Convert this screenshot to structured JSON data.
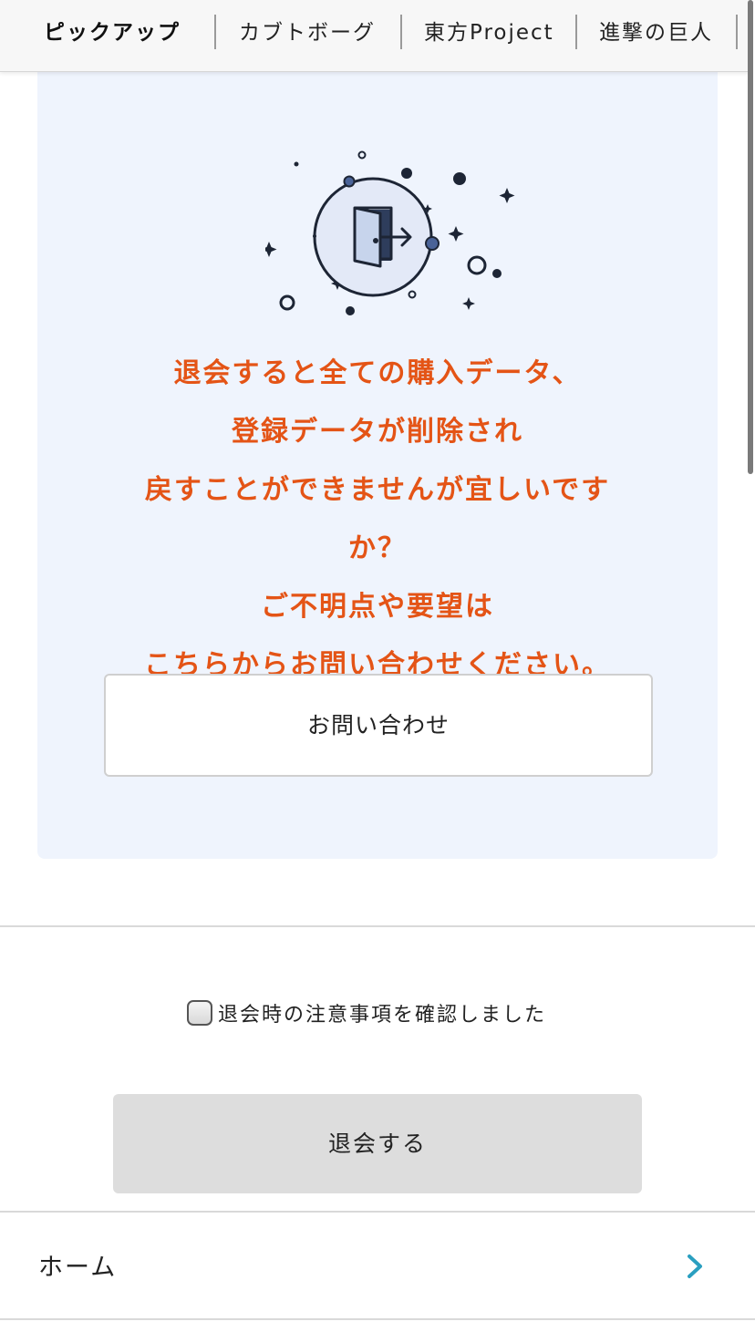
{
  "tabs": [
    {
      "label": "ピックアップ",
      "active": true
    },
    {
      "label": "カブトボーグ",
      "active": false
    },
    {
      "label": "東方Project",
      "active": false
    },
    {
      "label": "進撃の巨人",
      "active": false
    }
  ],
  "notice": {
    "illustration_icon": "door-exit-icon",
    "lines": [
      "退会すると全ての購入データ、",
      "登録データが削除され",
      "戻すことができませんが宜しいです",
      "か？",
      "ご不明点や要望は",
      "こちらからお問い合わせください。"
    ],
    "contact_button": "お問い合わせ"
  },
  "confirm": {
    "checkbox_label": "退会時の注意事項を確認しました",
    "checked": false
  },
  "withdraw_button": "退会する",
  "nav": {
    "home_label": "ホーム",
    "home_icon": "chevron-right-icon"
  },
  "colors": {
    "accent_text": "#e45416",
    "panel_bg": "#eff4fd",
    "chevron": "#2a9fc0",
    "disabled_button": "#dddddd"
  }
}
